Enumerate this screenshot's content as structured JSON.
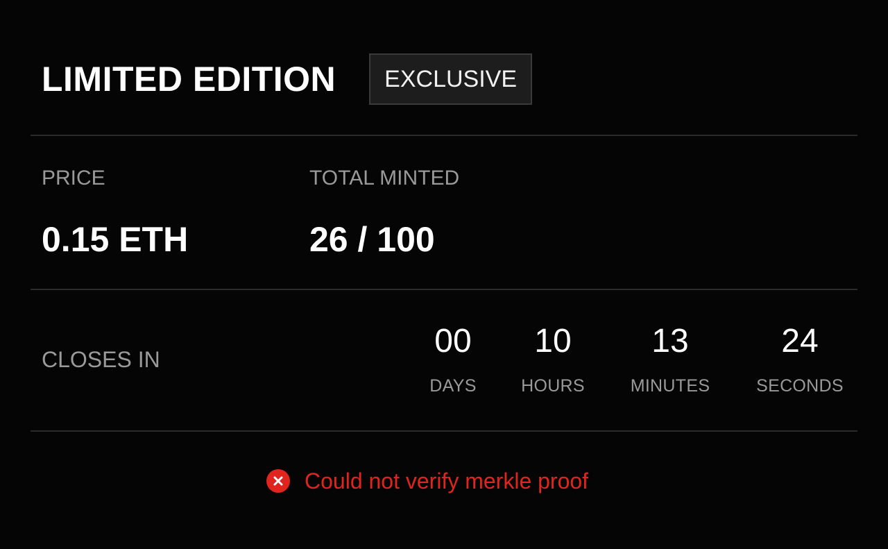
{
  "header": {
    "title": "LIMITED EDITION",
    "badge": "EXCLUSIVE"
  },
  "stats": {
    "price_label": "PRICE",
    "price_value": "0.15 ETH",
    "minted_label": "TOTAL MINTED",
    "minted_value": "26 / 100"
  },
  "countdown": {
    "label": "CLOSES IN",
    "units": [
      {
        "value": "00",
        "label": "DAYS"
      },
      {
        "value": "10",
        "label": "HOURS"
      },
      {
        "value": "13",
        "label": "MINUTES"
      },
      {
        "value": "24",
        "label": "SECONDS"
      }
    ]
  },
  "error": {
    "icon": "close-circle-icon",
    "message": "Could not verify merkle proof",
    "color": "#e0251f"
  }
}
